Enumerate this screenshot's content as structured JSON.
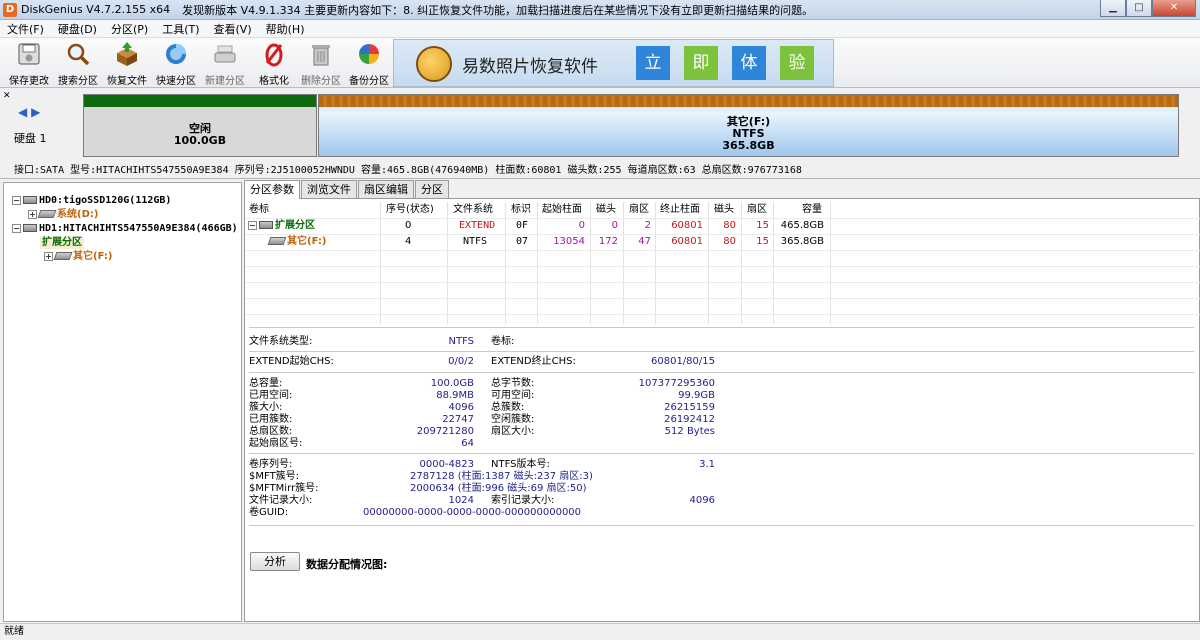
{
  "window": {
    "app_title": "DiskGenius V4.7.2.155 x64",
    "notice": "发现新版本 V4.9.1.334 主要更新内容如下：8. 纠正恢复文件功能，加载扫描进度后在某些情况下没有立即更新扫描结果的问题。",
    "icon_letter": "D"
  },
  "menu": [
    "文件(F)",
    "硬盘(D)",
    "分区(P)",
    "工具(T)",
    "查看(V)",
    "帮助(H)"
  ],
  "toolbar": [
    {
      "label": "保存更改",
      "icon": "save-icon"
    },
    {
      "label": "搜索分区",
      "icon": "magnifier-icon"
    },
    {
      "label": "恢复文件",
      "icon": "recover-box-icon"
    },
    {
      "label": "快速分区",
      "icon": "quick-partition-icon"
    },
    {
      "label": "新建分区",
      "icon": "new-partition-icon"
    },
    {
      "label": "格式化",
      "icon": "format-icon"
    },
    {
      "label": "删除分区",
      "icon": "trash-icon"
    },
    {
      "label": "备份分区",
      "icon": "backup-pie-icon"
    }
  ],
  "ad": {
    "text": "易数照片恢复软件",
    "boxes": [
      "立",
      "即",
      "体",
      "验"
    ],
    "box_colors": [
      "#2f86d8",
      "#7cc23c",
      "#2f86d8",
      "#7cc23c"
    ]
  },
  "disk_map": {
    "disk_label": "硬盘 1",
    "segments": [
      {
        "name": "空闲",
        "fs": "",
        "size": "100.0GB"
      },
      {
        "name": "其它(F:)",
        "fs": "NTFS",
        "size": "365.8GB"
      }
    ],
    "info": "接口:SATA  型号:HITACHIHTS547550A9E384  序列号:2J5100052HWNDU  容量:465.8GB(476940MB)  柱面数:60801  磁头数:255  每道扇区数:63  总扇区数:976773168"
  },
  "tree": {
    "nodes": [
      {
        "expander": "−",
        "label": "HD0:tigoSSD120G(112GB)",
        "color": "#000000"
      },
      {
        "expander": "+",
        "label": "系统(D:)",
        "color": "#c2620a"
      },
      {
        "expander": "−",
        "label": "HD1:HITACHIHTS547550A9E384(466GB)",
        "color": "#000000"
      },
      {
        "expander": "",
        "label": "扩展分区",
        "color": "#0a6b0a"
      },
      {
        "expander": "+",
        "label": "其它(F:)",
        "color": "#c2620a"
      }
    ]
  },
  "tabs": [
    "分区参数",
    "浏览文件",
    "扇区编辑",
    "分区"
  ],
  "partition_table": {
    "headers": [
      "卷标",
      "序号(状态)",
      "文件系统",
      "标识",
      "起始柱面",
      "磁头",
      "扇区",
      "终止柱面",
      "磁头",
      "扇区",
      "容量"
    ],
    "rows": [
      [
        "扩展分区",
        "0",
        "EXTEND",
        "0F",
        "0",
        "0",
        "2",
        "60801",
        "80",
        "15",
        "465.8GB"
      ],
      [
        "其它(F:)",
        "4",
        "NTFS",
        "07",
        "13054",
        "172",
        "47",
        "60801",
        "80",
        "15",
        "365.8GB"
      ]
    ]
  },
  "details": {
    "fs_type_label": "文件系统类型:",
    "fs_type": "NTFS",
    "vol_label_label": "卷标:",
    "vol_label": "",
    "extend_start_label": "EXTEND起始CHS:",
    "extend_start": "0/0/2",
    "extend_end_label": "EXTEND终止CHS:",
    "extend_end": "60801/80/15",
    "left_block": [
      [
        "总容量:",
        "100.0GB"
      ],
      [
        "已用空间:",
        "88.9MB"
      ],
      [
        "簇大小:",
        "4096"
      ],
      [
        "已用簇数:",
        "22747"
      ],
      [
        "总扇区数:",
        "209721280"
      ],
      [
        "起始扇区号:",
        "64"
      ]
    ],
    "right_block": [
      [
        "总字节数:",
        "107377295360"
      ],
      [
        "可用空间:",
        "99.9GB"
      ],
      [
        "总簇数:",
        "26215159"
      ],
      [
        "空闲簇数:",
        "26192412"
      ],
      [
        "扇区大小:",
        "512 Bytes"
      ]
    ],
    "serial_label": "卷序列号:",
    "serial": "0000-4823",
    "ntfs_ver_label": "NTFS版本号:",
    "ntfs_ver": "3.1",
    "mft_label": "$MFT簇号:",
    "mft": "2787128 (柱面:1387 磁头:237 扇区:3)",
    "mftmirr_label": "$MFTMirr簇号:",
    "mftmirr": "2000634 (柱面:996 磁头:69 扇区:50)",
    "rec_size_label": "文件记录大小:",
    "rec_size": "1024",
    "idx_size_label": "索引记录大小:",
    "idx_size": "4096",
    "guid_label": "卷GUID:",
    "guid": "00000000-0000-0000-0000-000000000000",
    "analyze_button": "分析",
    "alloc_label": "数据分配情况图:"
  },
  "status": "就绪"
}
